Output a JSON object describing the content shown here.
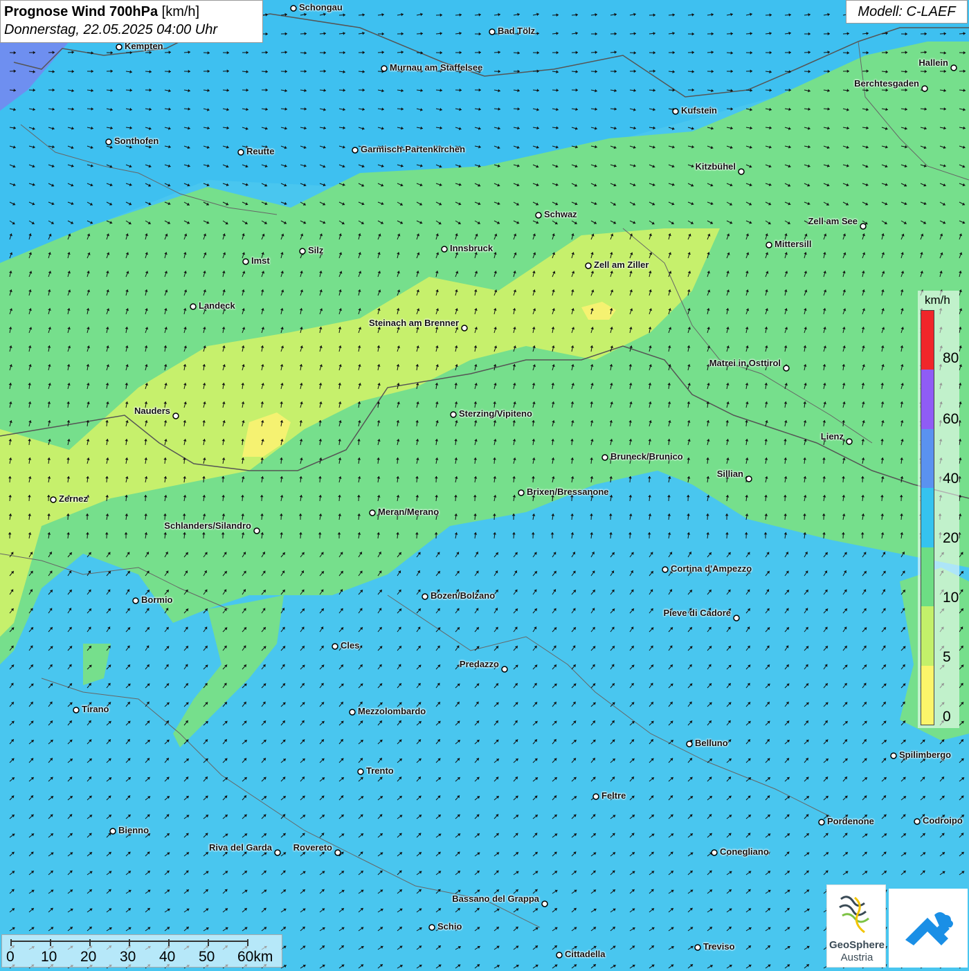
{
  "title": {
    "main": "Prognose Wind 700hPa",
    "unit": "[km/h]",
    "date": "Donnerstag, 22.05.2025 04:00 Uhr"
  },
  "model": "Modell: C-LAEF",
  "legend": {
    "unit": "km/h",
    "labels": [
      "80",
      "60",
      "40",
      "20",
      "10",
      "5",
      "0"
    ],
    "colors": [
      "#f0262a",
      "#8f5cf5",
      "#5a92f0",
      "#35c3ef",
      "#6ddd84",
      "#c3f06a",
      "#fcf56a"
    ]
  },
  "scale": {
    "labels": [
      "0",
      "10",
      "20",
      "30",
      "40",
      "50",
      "60km"
    ]
  },
  "logos": {
    "geosphere_name": "GeoSphere",
    "geosphere_sub": "Austria"
  },
  "cities": [
    {
      "name": "Schongau"
    },
    {
      "name": "Bad Tölz"
    },
    {
      "name": "Kempten"
    },
    {
      "name": "Murnau am Staffelsee"
    },
    {
      "name": "Hallein"
    },
    {
      "name": "Berchtesgaden"
    },
    {
      "name": "Kufstein"
    },
    {
      "name": "Sonthofen"
    },
    {
      "name": "Reutte"
    },
    {
      "name": "Garmisch-Partenkirchen"
    },
    {
      "name": "Kitzbühel"
    },
    {
      "name": "Schwaz"
    },
    {
      "name": "Zell am See"
    },
    {
      "name": "Mittersill"
    },
    {
      "name": "Innsbruck"
    },
    {
      "name": "Silz"
    },
    {
      "name": "Imst"
    },
    {
      "name": "Zell am Ziller"
    },
    {
      "name": "Landeck"
    },
    {
      "name": "Steinach am Brenner"
    },
    {
      "name": "Matrei in Osttirol"
    },
    {
      "name": "Nauders"
    },
    {
      "name": "Sterzing/Vipiteno"
    },
    {
      "name": "Lienz"
    },
    {
      "name": "Bruneck/Brunico"
    },
    {
      "name": "Sillian"
    },
    {
      "name": "Zernez"
    },
    {
      "name": "Brixen/Bressanone"
    },
    {
      "name": "Meran/Merano"
    },
    {
      "name": "Schlanders/Silandro"
    },
    {
      "name": "Cortina d'Ampezzo"
    },
    {
      "name": "Bozen/Bolzano"
    },
    {
      "name": "Bormio"
    },
    {
      "name": "Pieve di Cadore"
    },
    {
      "name": "Cles"
    },
    {
      "name": "Predazzo"
    },
    {
      "name": "Tirano"
    },
    {
      "name": "Mezzolombardo"
    },
    {
      "name": "Belluno"
    },
    {
      "name": "Spilimbergo"
    },
    {
      "name": "Trento"
    },
    {
      "name": "Feltre"
    },
    {
      "name": "Pordenone"
    },
    {
      "name": "Codroipo"
    },
    {
      "name": "Bienno"
    },
    {
      "name": "Riva del Garda"
    },
    {
      "name": "Rovereto"
    },
    {
      "name": "Conegliano"
    },
    {
      "name": "Bassano del Grappa"
    },
    {
      "name": "Schio"
    },
    {
      "name": "Treviso"
    },
    {
      "name": "Cittadella"
    }
  ]
}
